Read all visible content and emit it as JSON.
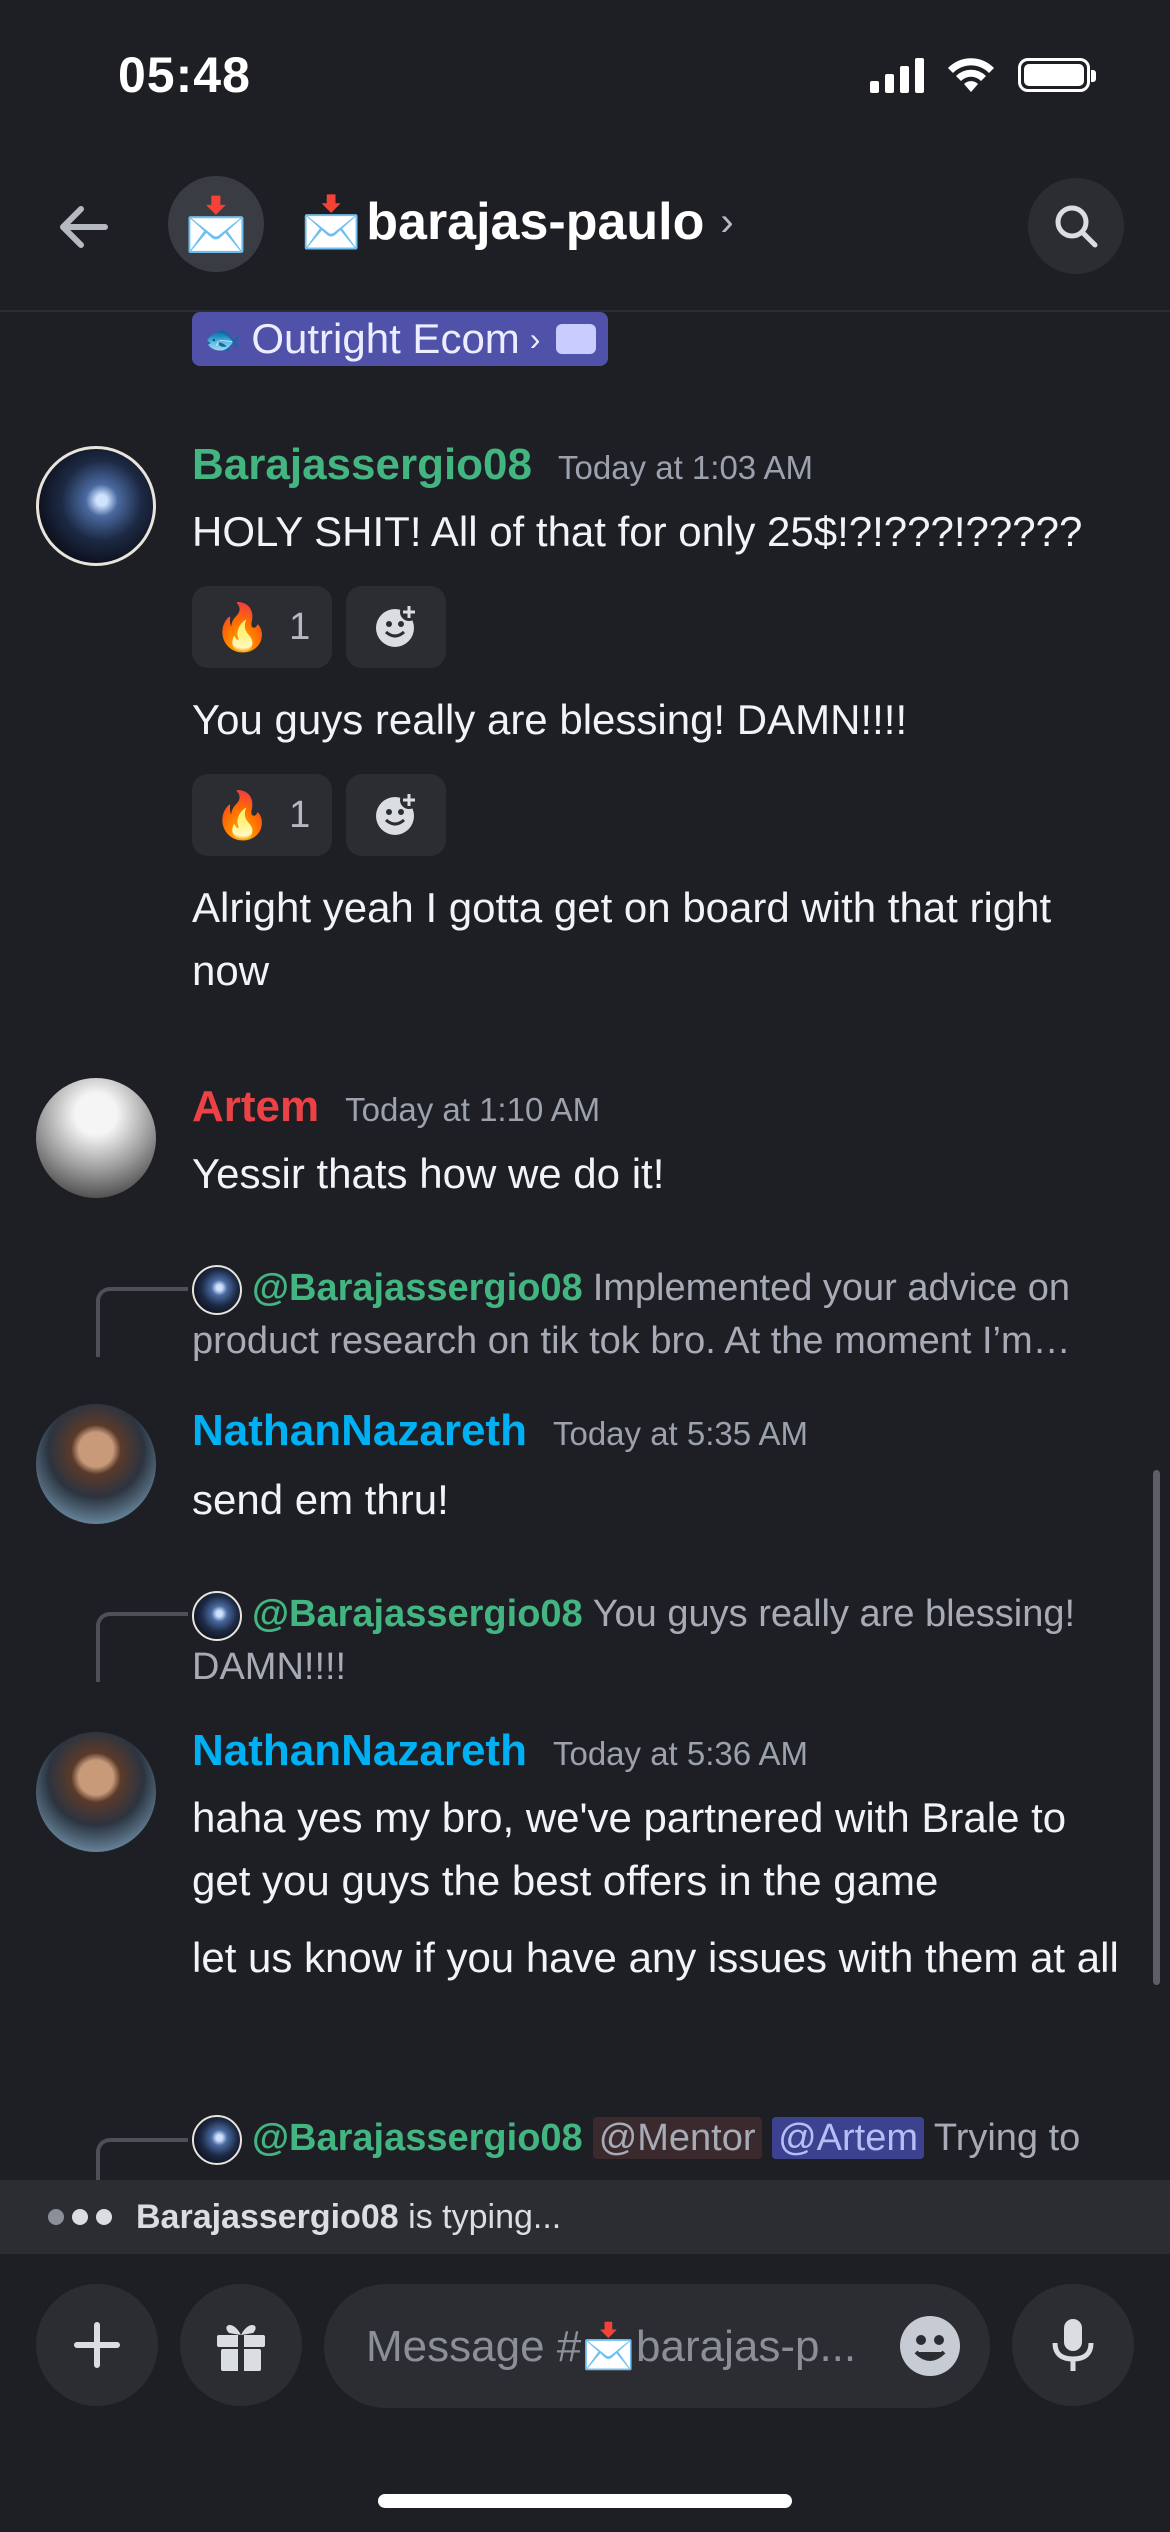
{
  "status_bar": {
    "time": "05:48"
  },
  "header": {
    "channel_emoji": "📩",
    "channel_name": "barajas-paulo",
    "chevron": "›"
  },
  "forum_link": {
    "emoji_mini": "🐟",
    "label": "Outright Ecom",
    "chevron": "›"
  },
  "messages": [
    {
      "author": "Barajassergio08",
      "author_color": "#43b581",
      "timestamp": "Today at 1:03 AM",
      "lines": [
        "HOLY SHIT! All of that for only 25$!?!???!?????",
        "You guys really are blessing! DAMN!!!!",
        "Alright yeah I gotta get on board with that right now"
      ],
      "reactions": [
        {
          "emoji": "🔥",
          "count": "1"
        },
        {
          "emoji": "🔥",
          "count": "1"
        }
      ]
    },
    {
      "author": "Artem",
      "author_color": "#ed4245",
      "timestamp": "Today at 1:10 AM",
      "lines": [
        "Yessir thats how we do it!"
      ]
    },
    {
      "reply_to": {
        "name": "@Barajassergio08",
        "text": "Implemented your advice on product research on tik tok bro. At the moment I’m…"
      },
      "author": "NathanNazareth",
      "author_color": "#00b0f4",
      "timestamp": "Today at 5:35 AM",
      "lines": [
        "send em thru!"
      ]
    },
    {
      "reply_to": {
        "name": "@Barajassergio08",
        "text": "You guys really are blessing! DAMN!!!!"
      },
      "author": "NathanNazareth",
      "author_color": "#00b0f4",
      "timestamp": "Today at 5:36 AM",
      "lines": [
        "haha yes my bro, we've partnered with Brale to get you guys the best offers in the game",
        "let us know if you have any issues with them at all"
      ]
    },
    {
      "reply_to": {
        "name": "@Barajassergio08",
        "mention_1": "@Mentor",
        "mention_2": "@Artem",
        "text": "Trying to"
      }
    }
  ],
  "typing": {
    "user": "Barajassergio08",
    "suffix": " is typing..."
  },
  "composer": {
    "placeholder": "Message #📩barajas-p..."
  },
  "icons": [
    "back-arrow-icon",
    "search-icon",
    "add-reaction-icon",
    "plus-icon",
    "gift-icon",
    "emoji-icon",
    "microphone-icon"
  ]
}
